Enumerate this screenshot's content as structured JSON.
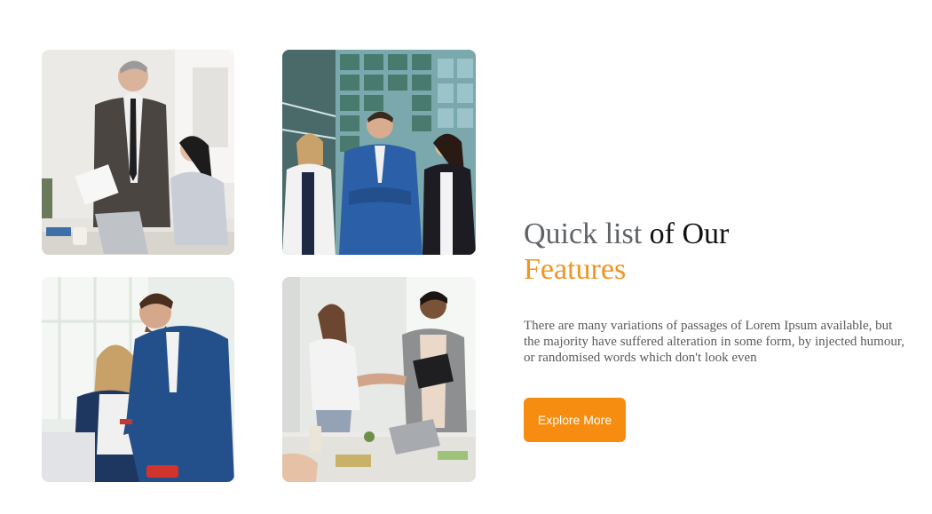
{
  "features": {
    "heading_part1": "Quick list",
    "heading_part2": " of Our",
    "heading_part3": "Features",
    "description": "There are many variations of passages of Lorem Ipsum available, but the majority have suffered alteration in some form, by injected humour, or randomised words which don't look even",
    "button_label": "Explore More"
  },
  "colors": {
    "accent": "#f39322",
    "button": "#f78d10",
    "heading_muted": "#5f6368",
    "heading_dark": "#111111",
    "body_text": "#5a5a5a"
  },
  "images": [
    {
      "name": "office-meeting-photo"
    },
    {
      "name": "business-team-photo"
    },
    {
      "name": "laptop-collaboration-photo"
    },
    {
      "name": "handshake-photo"
    }
  ]
}
